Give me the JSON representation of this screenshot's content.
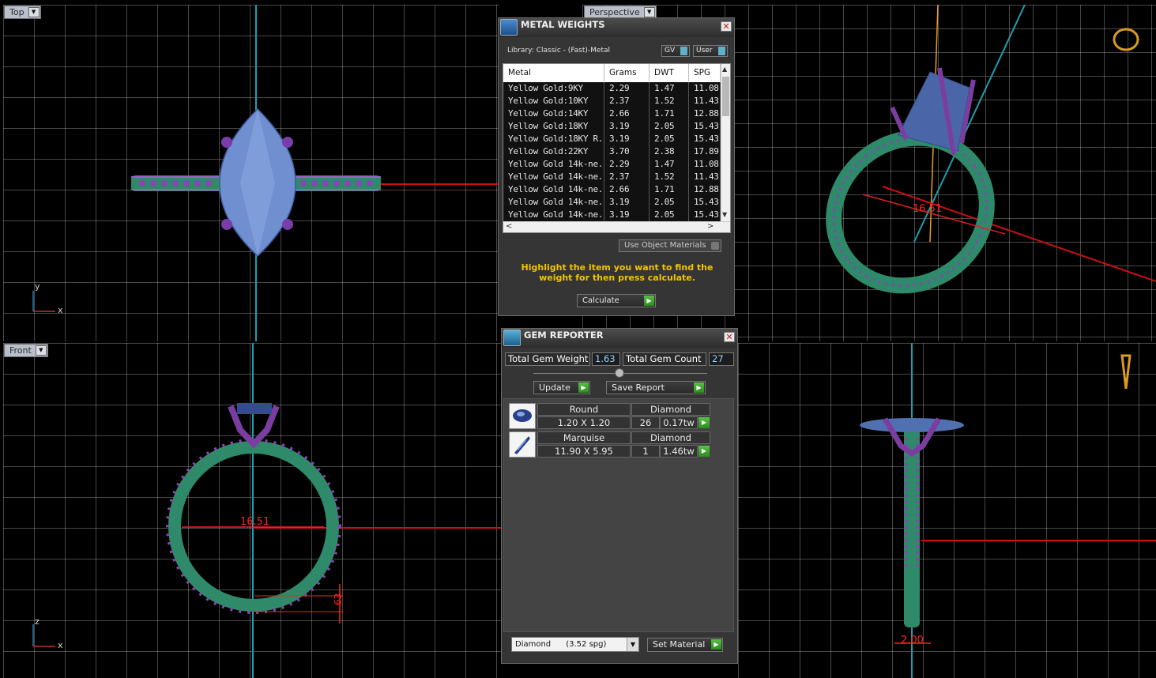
{
  "viewports": {
    "top": {
      "label": "Top"
    },
    "perspective": {
      "label": "Perspective"
    },
    "front": {
      "label": "Front"
    },
    "right": {
      "label": ""
    }
  },
  "dimensions": {
    "front_width": "16.51",
    "front_height": "63",
    "right_width": "2.00",
    "persp_width": "16.51"
  },
  "axes": {
    "top_x": "x",
    "top_y": "y",
    "front_x": "x",
    "front_z": "z"
  },
  "metal_weights": {
    "title": "METAL WEIGHTS",
    "library": "Library: Classic - (Fast)-Metal",
    "gv_label": "GV",
    "user_label": "User",
    "columns": [
      "Metal",
      "Grams",
      "DWT",
      "SPG"
    ],
    "rows": [
      {
        "metal": "Yellow Gold:9KY",
        "grams": "2.29",
        "dwt": "1.47",
        "spg": "11.08"
      },
      {
        "metal": "Yellow Gold:10KY",
        "grams": "2.37",
        "dwt": "1.52",
        "spg": "11.43"
      },
      {
        "metal": "Yellow Gold:14KY",
        "grams": "2.66",
        "dwt": "1.71",
        "spg": "12.88"
      },
      {
        "metal": "Yellow Gold:18KY",
        "grams": "3.19",
        "dwt": "2.05",
        "spg": "15.43"
      },
      {
        "metal": "Yellow Gold:18KY R...",
        "grams": "3.19",
        "dwt": "2.05",
        "spg": "15.43"
      },
      {
        "metal": "Yellow Gold:22KY",
        "grams": "3.70",
        "dwt": "2.38",
        "spg": "17.89"
      },
      {
        "metal": "Yellow Gold 14k-ne...",
        "grams": "2.29",
        "dwt": "1.47",
        "spg": "11.08"
      },
      {
        "metal": "Yellow Gold 14k-ne...",
        "grams": "2.37",
        "dwt": "1.52",
        "spg": "11.43"
      },
      {
        "metal": "Yellow Gold 14k-ne...",
        "grams": "2.66",
        "dwt": "1.71",
        "spg": "12.88"
      },
      {
        "metal": "Yellow Gold 14k-ne...",
        "grams": "3.19",
        "dwt": "2.05",
        "spg": "15.43"
      },
      {
        "metal": "Yellow Gold 14k-ne...",
        "grams": "3.19",
        "dwt": "2.05",
        "spg": "15.43"
      }
    ],
    "use_object_materials": "Use Object Materials",
    "hint": "Highlight the item you want to find the weight for then press calculate.",
    "calculate": "Calculate"
  },
  "gem_reporter": {
    "title": "GEM REPORTER",
    "total_weight_label": "Total Gem Weight",
    "total_weight": "1.63",
    "total_count_label": "Total Gem Count",
    "total_count": "27",
    "update": "Update",
    "save_report": "Save Report",
    "gems": [
      {
        "shape": "Round",
        "size": "1.20 X 1.20",
        "material": "Diamond",
        "count": "26",
        "weight": "0.17tw"
      },
      {
        "shape": "Marquise",
        "size": "11.90 X 5.95",
        "material": "Diamond",
        "count": "1",
        "weight": "1.46tw"
      }
    ],
    "material_select": "Diamond      (3.52 spg)",
    "set_material": "Set Material"
  },
  "colors": {
    "band": "#2e8a6a",
    "prong": "#7b3ea0",
    "gem": "#5f7ab8",
    "dim": "#ff2020"
  }
}
